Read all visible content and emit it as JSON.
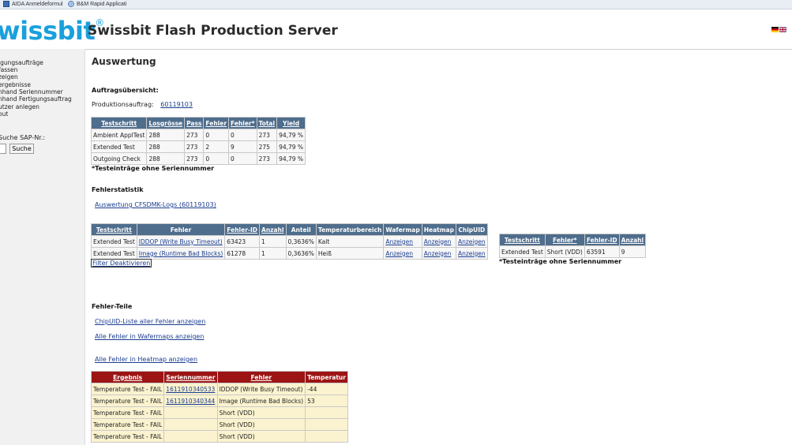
{
  "bookmarks": [
    "AIDA Anmeldeformul",
    "B&M Rapid Applicati"
  ],
  "header": {
    "logo": "wissbit",
    "logo_mark": "®",
    "title": "Swissbit Flash Production Server"
  },
  "sidebar": {
    "items": [
      "igungsaufträge",
      "fassen",
      "zeigen",
      "ergebnisse",
      "nhand Seriennummer",
      "nhand Fertigungsauftrag",
      "utzer anlegen",
      "out"
    ],
    "search_label": "Suche SAP-Nr.:",
    "search_value": "",
    "search_button": "Suche"
  },
  "main": {
    "title": "Auswertung",
    "summary": {
      "heading": "Auftragsübersicht:",
      "order_label": "Produktionsauftrag:",
      "order_link": "60119103",
      "columns": [
        "Testschritt",
        "Losgrösse",
        "Pass",
        "Fehler",
        "Fehler*",
        "Total",
        "Yield"
      ],
      "rows": [
        [
          "Ambient ApplTest",
          "288",
          "273",
          "0",
          "0",
          "273",
          "94,79 %"
        ],
        [
          "Extended Test",
          "288",
          "273",
          "2",
          "9",
          "275",
          "94,79 %"
        ],
        [
          "Outgoing Check",
          "288",
          "273",
          "0",
          "0",
          "273",
          "94,79 %"
        ]
      ],
      "note": "*Testeinträge ohne Seriennummer"
    },
    "stats": {
      "heading": "Fehlerstatistik",
      "link": "Auswertung CFSDMK-Logs (60119103)",
      "columns": [
        "Testschritt",
        "Fehler",
        "Fehler-ID",
        "Anzahl",
        "Anteil",
        "Temperaturbereich",
        "Wafermap",
        "Heatmap",
        "ChipUID"
      ],
      "rows": [
        [
          "Extended Test",
          "IDDOP (Write Busy Timeout)",
          "63423",
          "1",
          "0,3636%",
          "Kalt",
          "Anzeigen",
          "Anzeigen",
          "Anzeigen"
        ],
        [
          "Extended Test",
          "Image (Runtime Bad Blocks)",
          "61278",
          "1",
          "0,3636%",
          "Heiß",
          "Anzeigen",
          "Anzeigen",
          "Anzeigen"
        ]
      ],
      "filter_button": "Filter Deaktivieren",
      "side_columns": [
        "Testschritt",
        "Fehler*",
        "Fehler-ID",
        "Anzahl"
      ],
      "side_rows": [
        [
          "Extended Test",
          "Short (VDD)",
          "63591",
          "9"
        ]
      ],
      "side_note": "*Testeinträge ohne Seriennummer"
    },
    "parts": {
      "heading": "Fehler-Teile",
      "links": [
        "ChipUID-Liste aller Fehler anzeigen",
        "Alle Fehler in Wafermaps anzeigen",
        "Alle Fehler in Heatmap anzeigen"
      ],
      "columns": [
        "Ergebnis",
        "Seriennummer",
        "Fehler",
        "Temperatur"
      ],
      "rows": [
        [
          "Temperature Test - FAIL",
          "1611910340533",
          "IDDOP (Write Busy Timeout)",
          "-44"
        ],
        [
          "Temperature Test - FAIL",
          "1611910340344",
          "Image (Runtime Bad Blocks)",
          "53"
        ],
        [
          "Temperature Test - FAIL",
          "",
          "Short (VDD)",
          ""
        ],
        [
          "Temperature Test - FAIL",
          "",
          "Short (VDD)",
          ""
        ],
        [
          "Temperature Test - FAIL",
          "",
          "Short (VDD)",
          ""
        ]
      ]
    }
  }
}
